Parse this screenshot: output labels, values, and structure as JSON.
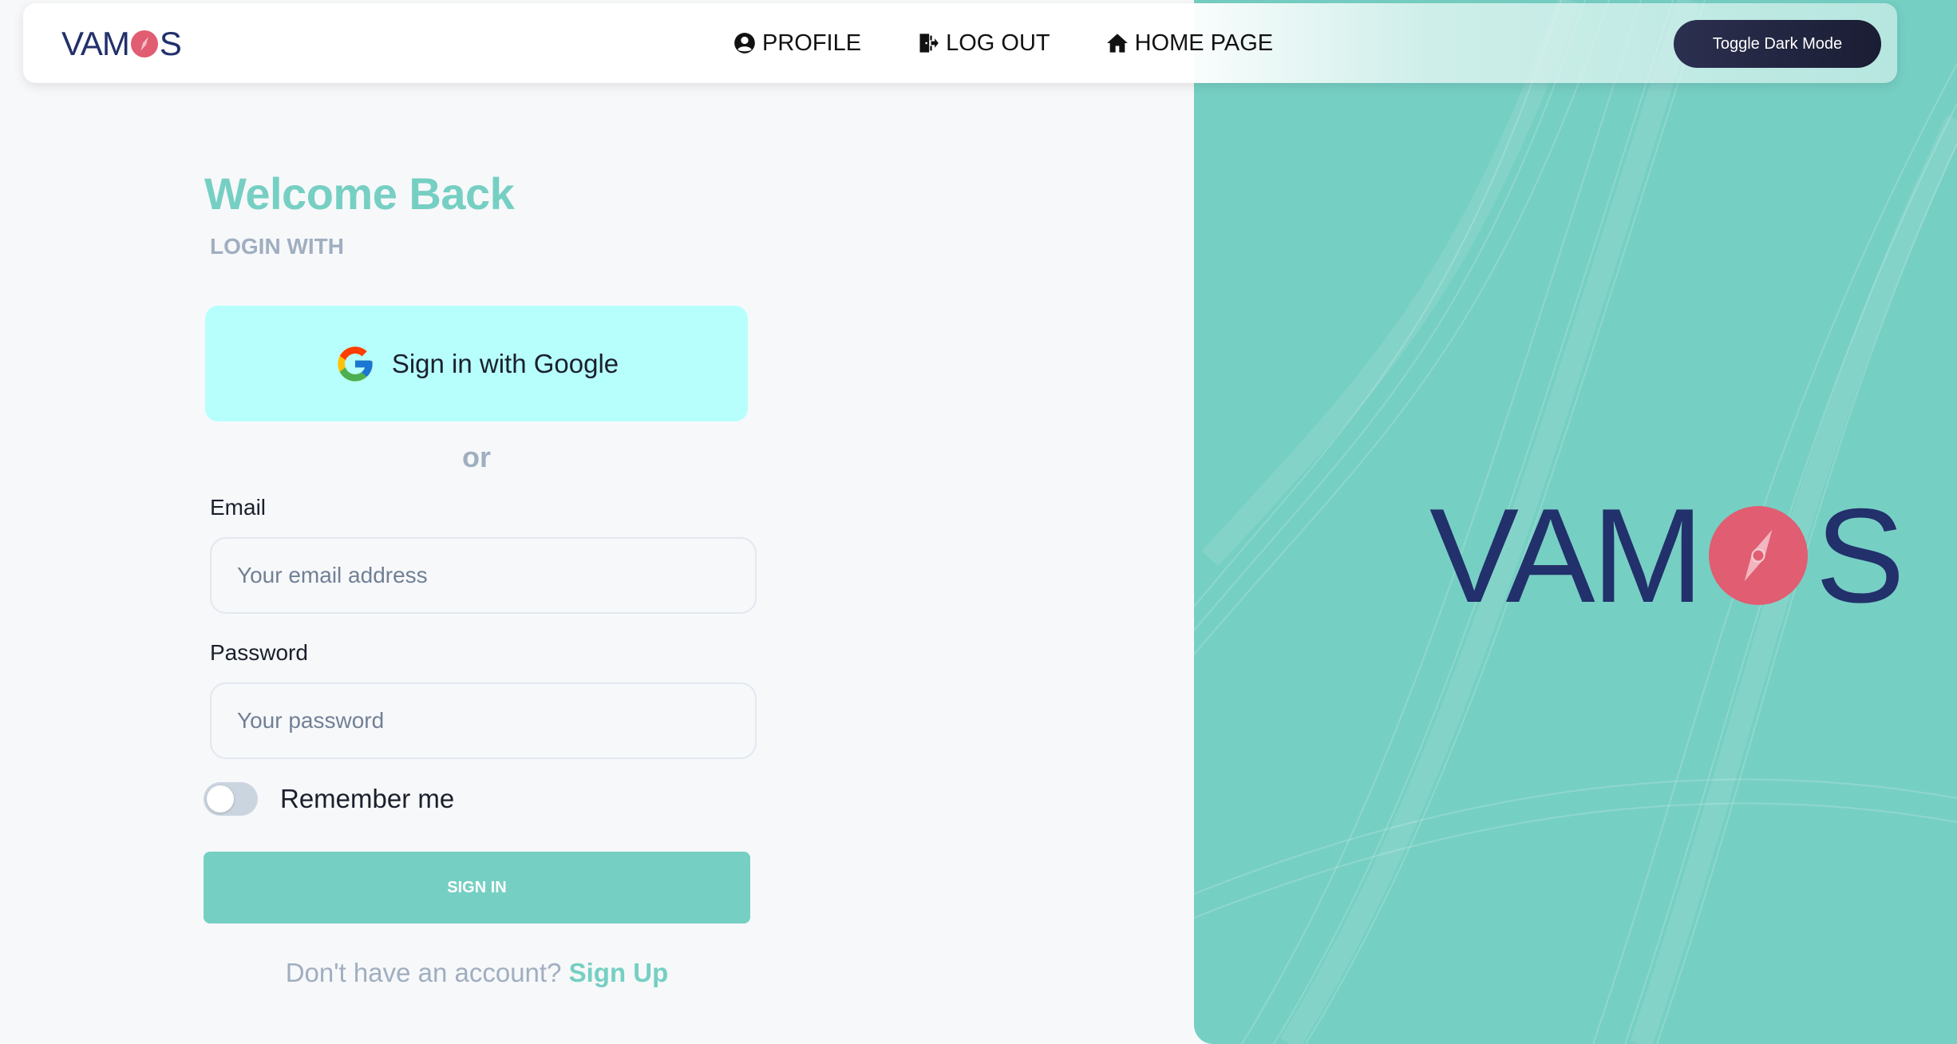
{
  "brand": {
    "logo_left": "VAM",
    "logo_right": "S",
    "hero_logo_left": "VAM",
    "hero_logo_right": "S",
    "navy": "#22306b",
    "accent": "#76cfc3",
    "compass_red": "#e05d72"
  },
  "navbar": {
    "links": [
      {
        "label": "PROFILE",
        "icon": "user-circle-icon"
      },
      {
        "label": "LOG OUT",
        "icon": "logout-door-icon"
      },
      {
        "label": "HOME PAGE",
        "icon": "home-icon"
      }
    ],
    "toggle_label": "Toggle Dark Mode"
  },
  "login": {
    "title": "Welcome Back",
    "subtitle": "LOGIN WITH",
    "google_label": "Sign in with Google",
    "or_label": "or",
    "email": {
      "label": "Email",
      "placeholder": "Your email address",
      "value": ""
    },
    "password": {
      "label": "Password",
      "placeholder": "Your password",
      "value": ""
    },
    "remember_label": "Remember me",
    "remember_checked": false,
    "submit_label": "SIGN IN",
    "signup_prompt": "Don't have an account?",
    "signup_link": "Sign Up"
  }
}
